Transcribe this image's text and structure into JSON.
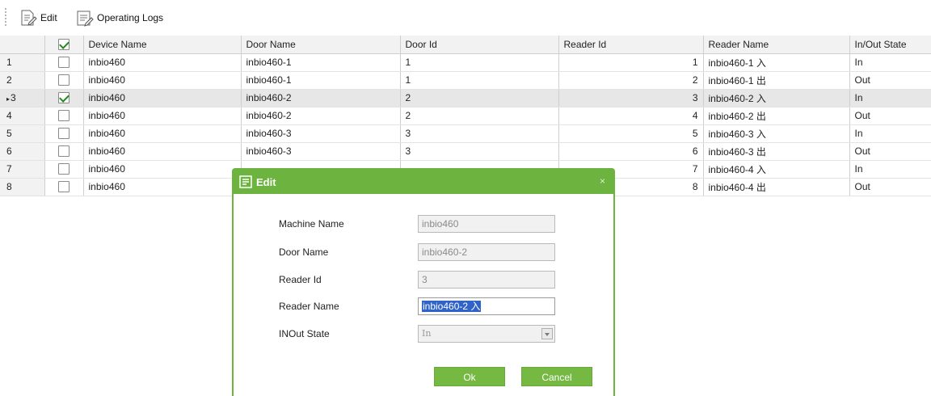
{
  "toolbar": {
    "edit_label": "Edit",
    "logs_label": "Operating Logs"
  },
  "grid": {
    "columns": [
      "Device Name",
      "Door Name",
      "Door Id",
      "Reader Id",
      "Reader Name",
      "In/Out State"
    ],
    "header_checked": true,
    "selected_row": 3,
    "rows": [
      {
        "num": "1",
        "checked": false,
        "device": "inbio460",
        "door": "inbio460-1",
        "door_id": "1",
        "reader_id": "1",
        "reader_name": "inbio460-1 入",
        "state": "In"
      },
      {
        "num": "2",
        "checked": false,
        "device": "inbio460",
        "door": "inbio460-1",
        "door_id": "1",
        "reader_id": "2",
        "reader_name": "inbio460-1 出",
        "state": "Out"
      },
      {
        "num": "3",
        "checked": true,
        "device": "inbio460",
        "door": "inbio460-2",
        "door_id": "2",
        "reader_id": "3",
        "reader_name": "inbio460-2 入",
        "state": "In"
      },
      {
        "num": "4",
        "checked": false,
        "device": "inbio460",
        "door": "inbio460-2",
        "door_id": "2",
        "reader_id": "4",
        "reader_name": "inbio460-2 出",
        "state": "Out"
      },
      {
        "num": "5",
        "checked": false,
        "device": "inbio460",
        "door": "inbio460-3",
        "door_id": "3",
        "reader_id": "5",
        "reader_name": "inbio460-3 入",
        "state": "In"
      },
      {
        "num": "6",
        "checked": false,
        "device": "inbio460",
        "door": "inbio460-3",
        "door_id": "3",
        "reader_id": "6",
        "reader_name": "inbio460-3 出",
        "state": "Out"
      },
      {
        "num": "7",
        "checked": false,
        "device": "inbio460",
        "door": "",
        "door_id": "",
        "reader_id": "7",
        "reader_name": "inbio460-4 入",
        "state": "In"
      },
      {
        "num": "8",
        "checked": false,
        "device": "inbio460",
        "door": "",
        "door_id": "",
        "reader_id": "8",
        "reader_name": "inbio460-4 出",
        "state": "Out"
      }
    ]
  },
  "dialog": {
    "title": "Edit",
    "close": "×",
    "fields": {
      "machine_name_label": "Machine Name",
      "machine_name_value": "inbio460",
      "door_name_label": "Door Name",
      "door_name_value": "inbio460-2",
      "reader_id_label": "Reader Id",
      "reader_id_value": "3",
      "reader_name_label": "Reader Name",
      "reader_name_value": "inbio460-2 入",
      "inout_label": "INOut State",
      "inout_value": "In"
    },
    "ok_label": "Ok",
    "cancel_label": "Cancel"
  },
  "colors": {
    "accent_green": "#6db33f",
    "selected_row": "#e7e7e7",
    "text_highlight": "#2f63c8"
  }
}
